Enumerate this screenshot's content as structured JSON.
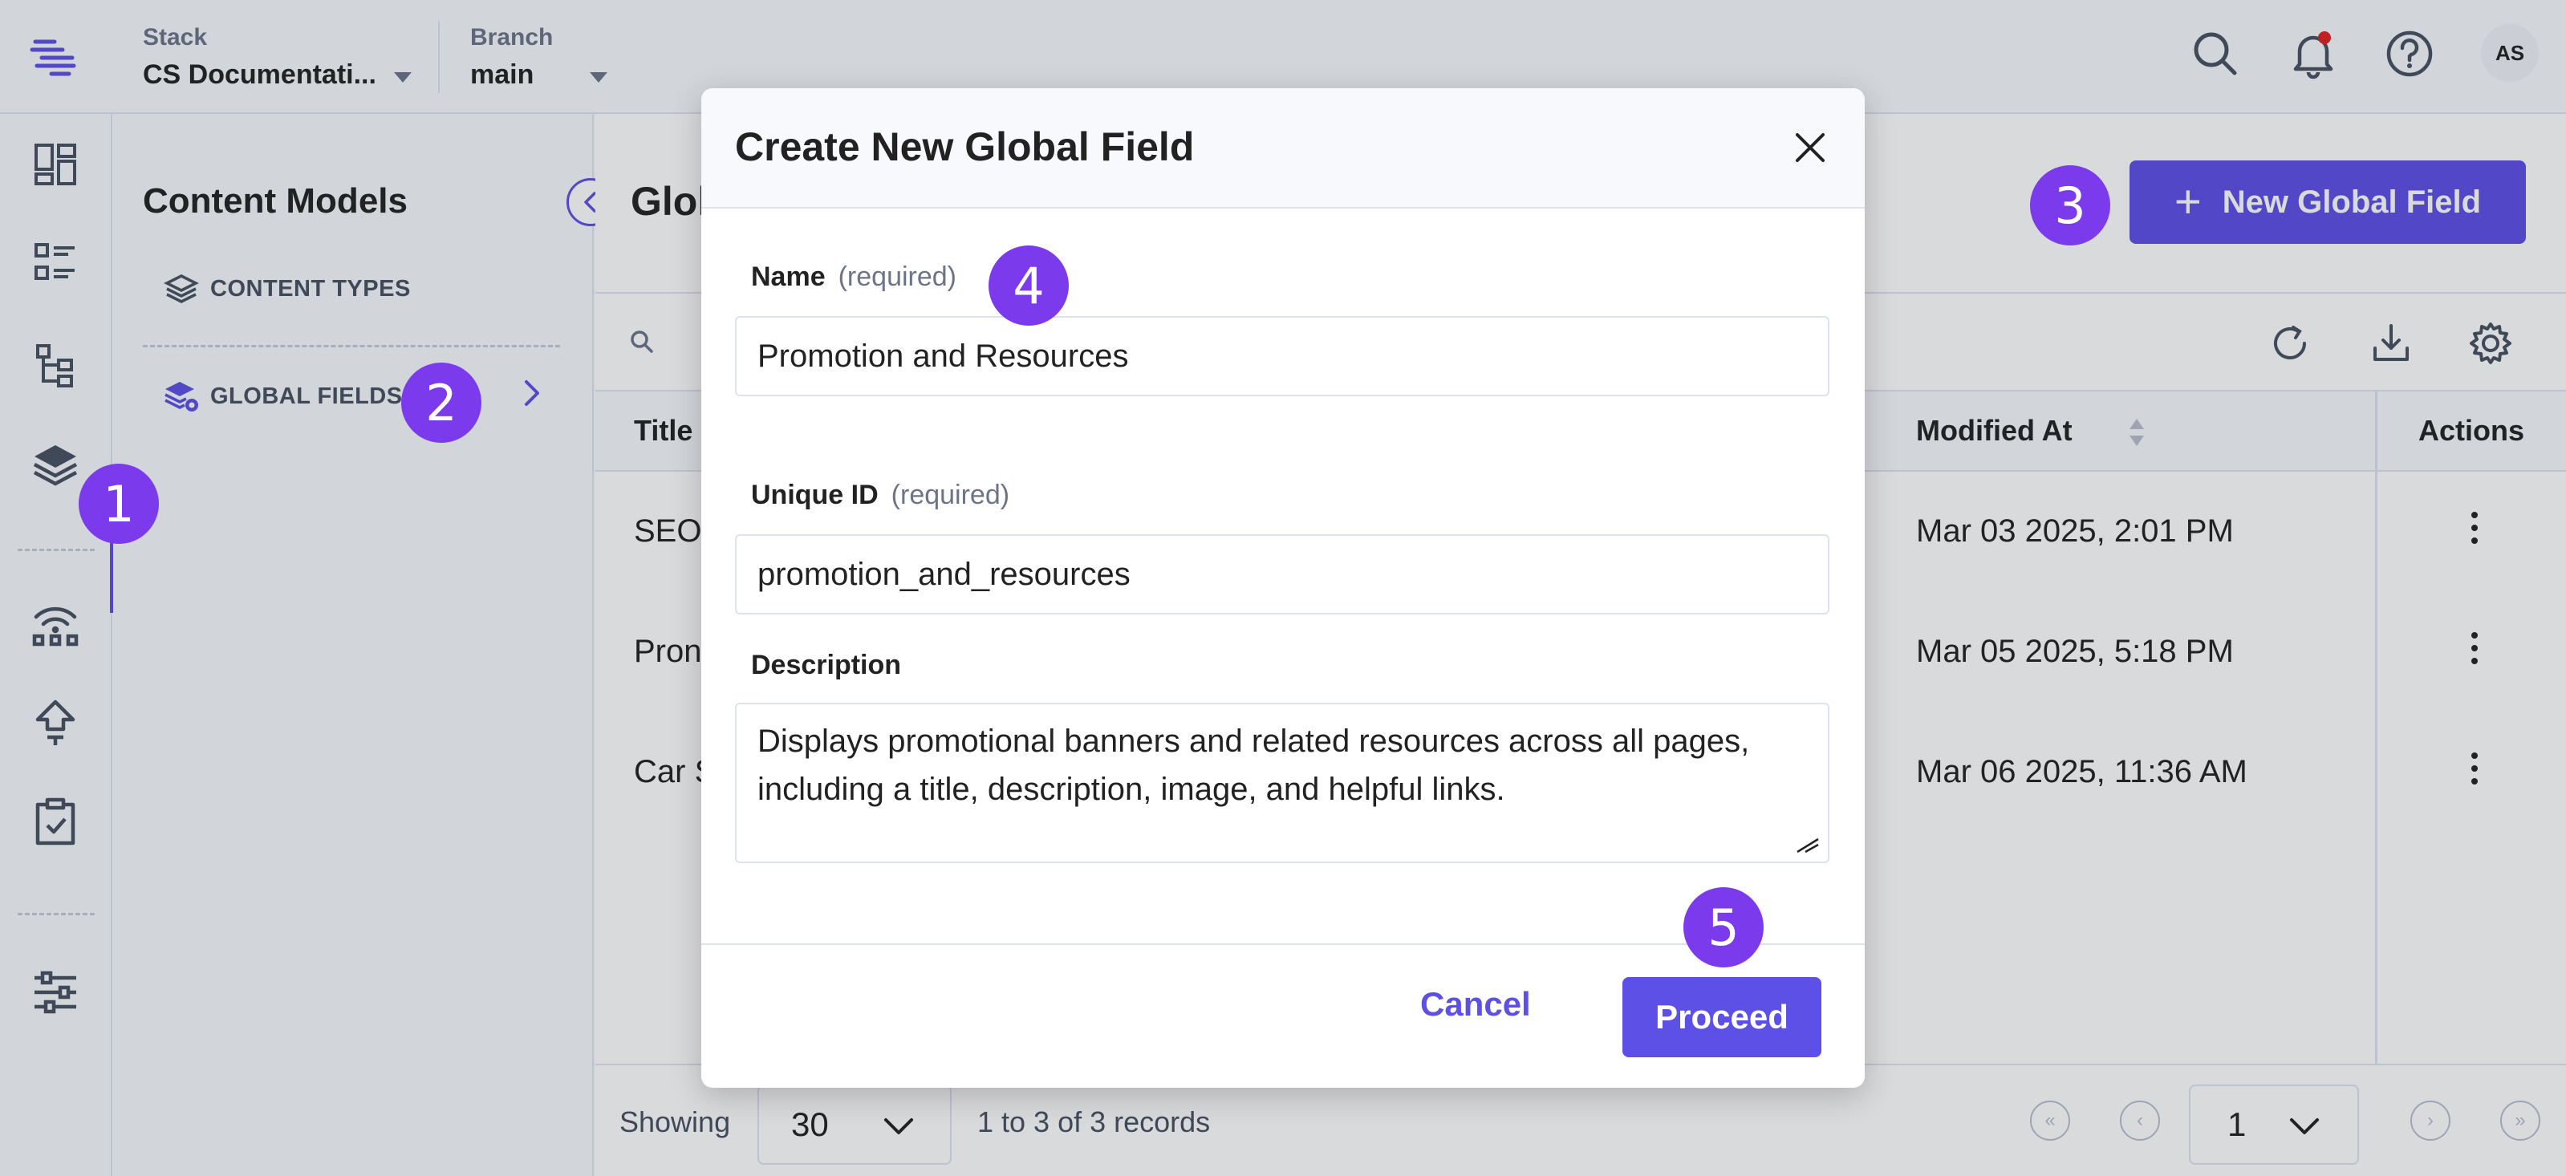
{
  "header": {
    "stack_label": "Stack",
    "stack_value": "CS Documentati...",
    "branch_label": "Branch",
    "branch_value": "main",
    "avatar_initials": "AS"
  },
  "content_models": {
    "title": "Content Models",
    "items": [
      {
        "label": "CONTENT TYPES",
        "icon": "layers-icon"
      },
      {
        "label": "GLOBAL FIELDS",
        "icon": "global-fields-icon"
      }
    ]
  },
  "main": {
    "title_partial": "Glol",
    "new_button_label": "New Global Field",
    "columns": {
      "title": "Title",
      "modified": "Modified At",
      "actions": "Actions"
    },
    "rows": [
      {
        "title": "SEO",
        "modified": "Mar 03 2025, 2:01 PM"
      },
      {
        "title": "Pron",
        "modified": "Mar 05 2025, 5:18 PM"
      },
      {
        "title": "Car S",
        "modified": "Mar 06 2025, 11:36 AM"
      }
    ],
    "footer": {
      "showing_label": "Showing",
      "per_page": "30",
      "records_text": "1 to 3 of 3 records",
      "current_page": "1"
    }
  },
  "modal": {
    "title": "Create New Global Field",
    "name_label": "Name",
    "required_text": "(required)",
    "name_value": "Promotion and Resources",
    "uid_label": "Unique ID",
    "uid_value": "promotion_and_resources",
    "description_label": "Description",
    "description_value": "Displays promotional banners and related resources across all pages, including a title, description, image, and helpful links.",
    "cancel_label": "Cancel",
    "proceed_label": "Proceed"
  },
  "badges": [
    "1",
    "2",
    "3",
    "4",
    "5"
  ],
  "colors": {
    "accent": "#5d50e6",
    "badge": "#7c3aed",
    "notification": "#e02020"
  }
}
